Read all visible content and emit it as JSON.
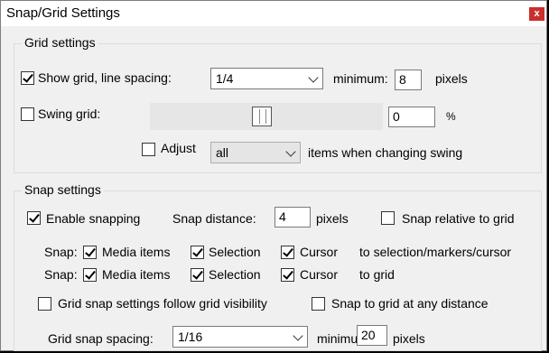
{
  "window": {
    "title": "Snap/Grid Settings",
    "close_glyph": "x"
  },
  "grid": {
    "legend": "Grid settings",
    "show_grid": {
      "label": "Show grid, line spacing:",
      "checked": true
    },
    "spacing": {
      "value": "1/4"
    },
    "minimum_label": "minimum:",
    "minimum_value": "8",
    "pixels_label": "pixels",
    "swing": {
      "label": "Swing grid:",
      "checked": false,
      "slider_level": 0.5,
      "value": "0",
      "unit": "%"
    },
    "adjust": {
      "label": "Adjust",
      "checked": false,
      "value": "all",
      "suffix": "items when changing swing"
    }
  },
  "snap": {
    "legend": "Snap settings",
    "enable": {
      "label": "Enable snapping",
      "checked": true
    },
    "distance_label": "Snap distance:",
    "distance_value": "4",
    "distance_unit": "pixels",
    "relative": {
      "label": "Snap relative to grid",
      "checked": false
    },
    "row1": {
      "prefix": "Snap:",
      "media": "Media items",
      "selection": "Selection",
      "cursor": "Cursor",
      "suffix": "to selection/markers/cursor"
    },
    "row2": {
      "prefix": "Snap:",
      "media": "Media items",
      "selection": "Selection",
      "cursor": "Cursor",
      "suffix": "to grid"
    },
    "follow_visibility": {
      "label": "Grid snap settings follow grid visibility",
      "checked": false
    },
    "any_distance": {
      "label": "Snap to grid at any distance",
      "checked": false
    },
    "spacing_label": "Grid snap spacing:",
    "spacing_value": "1/16",
    "minimum_label": "minimum:",
    "minimum_value": "20",
    "pixels_label": "pixels"
  }
}
